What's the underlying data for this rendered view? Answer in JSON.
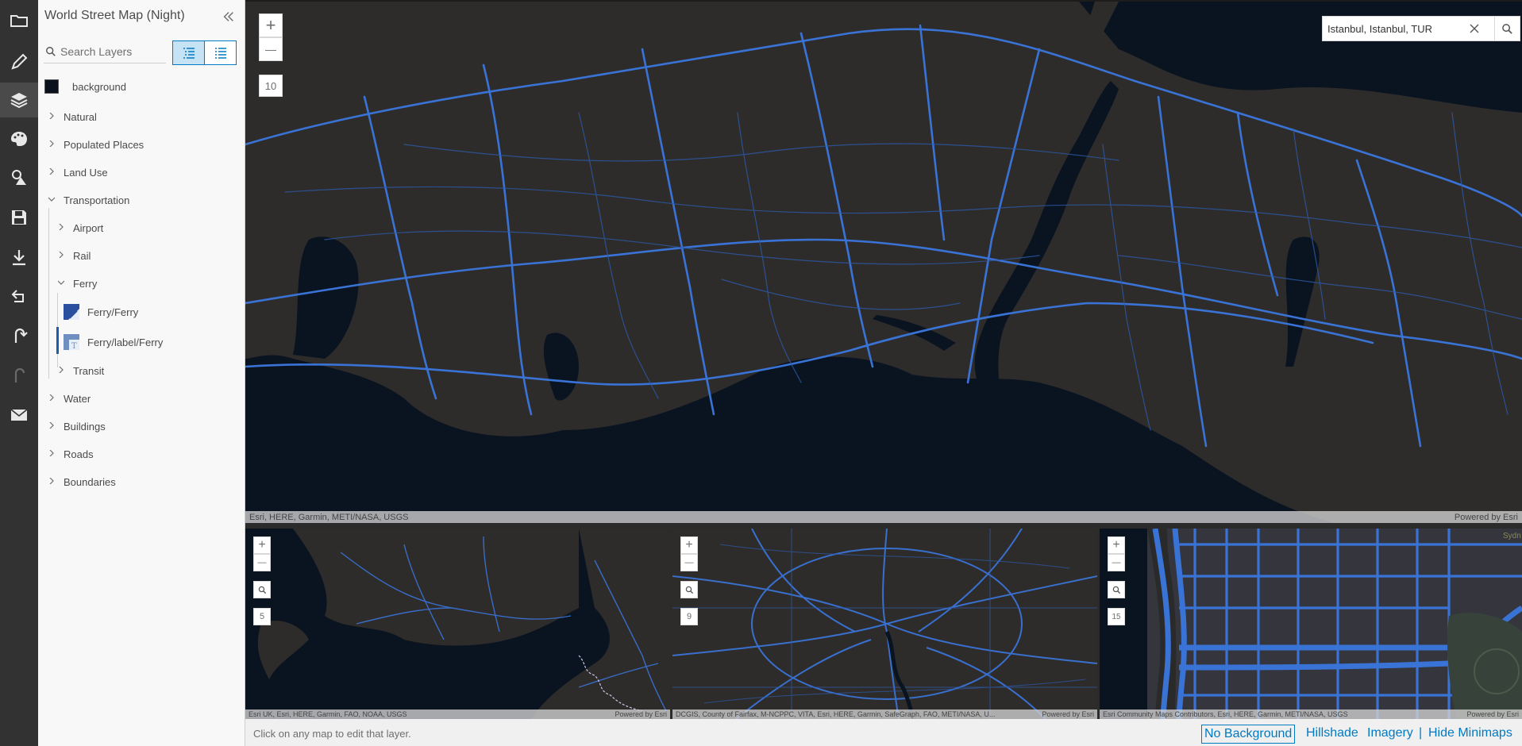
{
  "toolbar": {
    "items": [
      {
        "icon": "folder-icon",
        "label": "Open"
      },
      {
        "icon": "pencil-icon",
        "label": "Edit"
      },
      {
        "icon": "layers-icon",
        "label": "Layers"
      },
      {
        "icon": "palette-icon",
        "label": "Style"
      },
      {
        "icon": "image-shapes-icon",
        "label": "Sprites"
      },
      {
        "icon": "save-icon",
        "label": "Save"
      },
      {
        "icon": "download-icon",
        "label": "Download"
      },
      {
        "icon": "share-icon",
        "label": "Share"
      },
      {
        "icon": "undo-icon",
        "label": "Undo"
      },
      {
        "icon": "redo-icon",
        "label": "Redo"
      },
      {
        "icon": "mail-icon",
        "label": "Feedback"
      }
    ]
  },
  "panel": {
    "title": "World Street Map (Night)",
    "search_placeholder": "Search Layers",
    "background_label": "background",
    "groups": {
      "natural": "Natural",
      "populated_places": "Populated Places",
      "land_use": "Land Use",
      "transportation": "Transportation",
      "airport": "Airport",
      "rail": "Rail",
      "ferry": "Ferry",
      "ferry_layer": "Ferry/Ferry",
      "ferry_label_layer": "Ferry/label/Ferry",
      "transit": "Transit",
      "water": "Water",
      "buildings": "Buildings",
      "roads": "Roads",
      "boundaries": "Boundaries"
    }
  },
  "map": {
    "zoom_in": "+",
    "zoom_out": "—",
    "zoom_level": "10",
    "search_value": "Istanbul, Istanbul, TUR",
    "attribution": "Esri, HERE, Garmin, METI/NASA, USGS",
    "powered_by": "Powered by Esri"
  },
  "minimaps": [
    {
      "zoom_level": "5",
      "attribution": "Esri UK, Esri, HERE, Garmin, FAO, NOAA, USGS",
      "powered_by": "Powered by Esri"
    },
    {
      "zoom_level": "9",
      "attribution": "DCGIS, County of Fairfax, M-NCPPC, VITA, Esri, HERE, Garmin, SafeGraph, FAO, METI/NASA, U...",
      "powered_by": "Powered by Esri"
    },
    {
      "zoom_level": "15",
      "attribution": "Esri Community Maps Contributors, Esri, HERE, Garmin, METI/NASA, USGS",
      "powered_by": "Powered by Esri",
      "corner_label": "Sydn"
    }
  ],
  "footer": {
    "hint": "Click on any map to edit that layer.",
    "options": [
      "No Background",
      "Hillshade",
      "Imagery"
    ],
    "separator": "|",
    "hide_minimaps": "Hide Minimaps"
  },
  "colors": {
    "road": "#3a73d6",
    "land": "#2e2c2b",
    "water": "#0a1421",
    "accent": "#007ac2"
  }
}
